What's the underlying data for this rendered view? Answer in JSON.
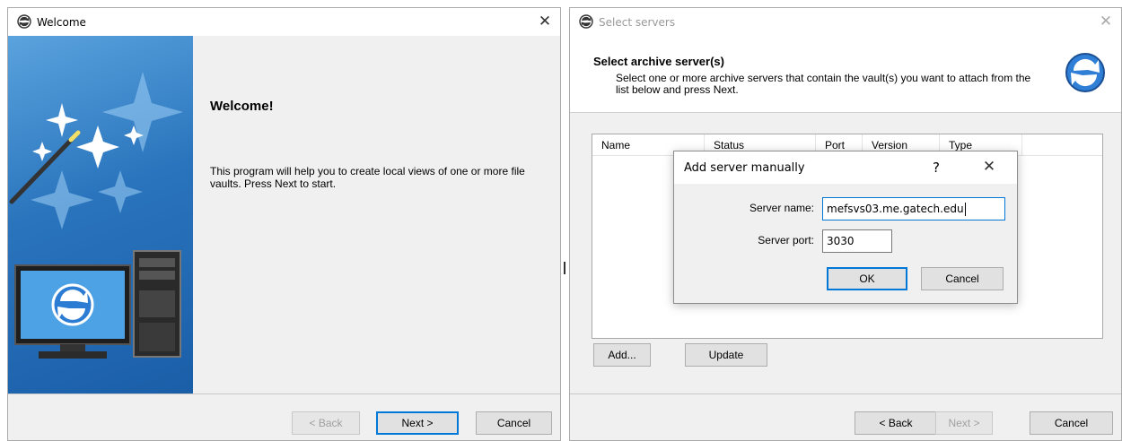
{
  "welcome_window": {
    "title": "Welcome",
    "heading": "Welcome!",
    "body_text": "This program will help you to create local views of one or more file vaults. Press Next to start.",
    "buttons": {
      "back": "< Back",
      "next": "Next >",
      "cancel": "Cancel"
    },
    "icons": {
      "title": "sync-globe-icon",
      "banner": "magic-wand-computer-icon"
    }
  },
  "servers_window": {
    "title": "Select servers",
    "heading": "Select archive server(s)",
    "description": "Select one or more archive servers that contain the vault(s) you want to attach from the list below and press Next.",
    "columns": [
      "Name",
      "Status",
      "Port",
      "Version",
      "Type"
    ],
    "buttons": {
      "add": "Add...",
      "update": "Update",
      "back": "< Back",
      "next": "Next >",
      "cancel": "Cancel"
    },
    "icons": {
      "title": "sync-globe-icon",
      "logo": "sync-arrows-icon"
    }
  },
  "dialog": {
    "title": "Add server manually",
    "help": "?",
    "server_name_label": "Server name:",
    "server_name_value": "mefsvs03.me.gatech.edu",
    "server_port_label": "Server port:",
    "server_port_value": "3030",
    "buttons": {
      "ok": "OK",
      "cancel": "Cancel"
    }
  },
  "colors": {
    "accent": "#0078d7",
    "banner": "#2a74bd",
    "window_bg": "#f0f0f0"
  }
}
